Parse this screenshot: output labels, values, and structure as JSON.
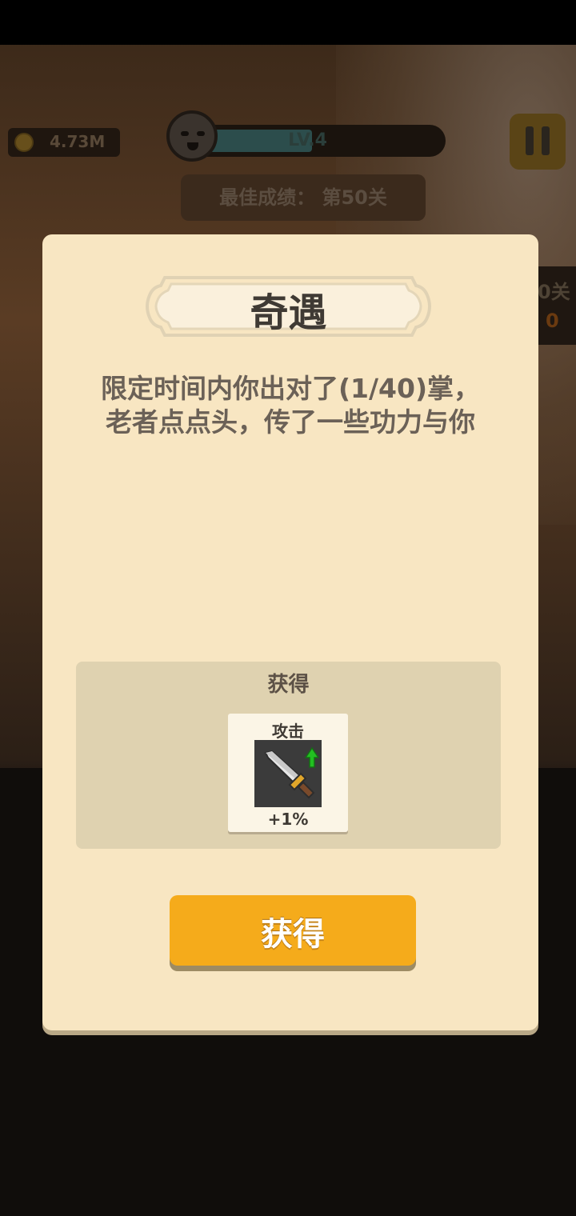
{
  "hud": {
    "coins": "4.73M",
    "level": "LV.4",
    "level_progress": 0.45,
    "best_score": "最佳成绩： 第50关",
    "side_label": "0关",
    "side_number": "0"
  },
  "dialog": {
    "title": "奇遇",
    "message_line1": "限定时间内你出对了(1/40)掌，",
    "message_line2": "老者点点头，传了一些功力与你",
    "reward_title": "获得",
    "reward": {
      "label": "攻击",
      "icon": "sword-icon",
      "value": "+1%"
    },
    "claim_label": "获得"
  },
  "colors": {
    "panel": "#f8e6c2",
    "button": "#f5ab1b",
    "reward_box": "#dfd2b0",
    "arrow": "#22c021"
  }
}
